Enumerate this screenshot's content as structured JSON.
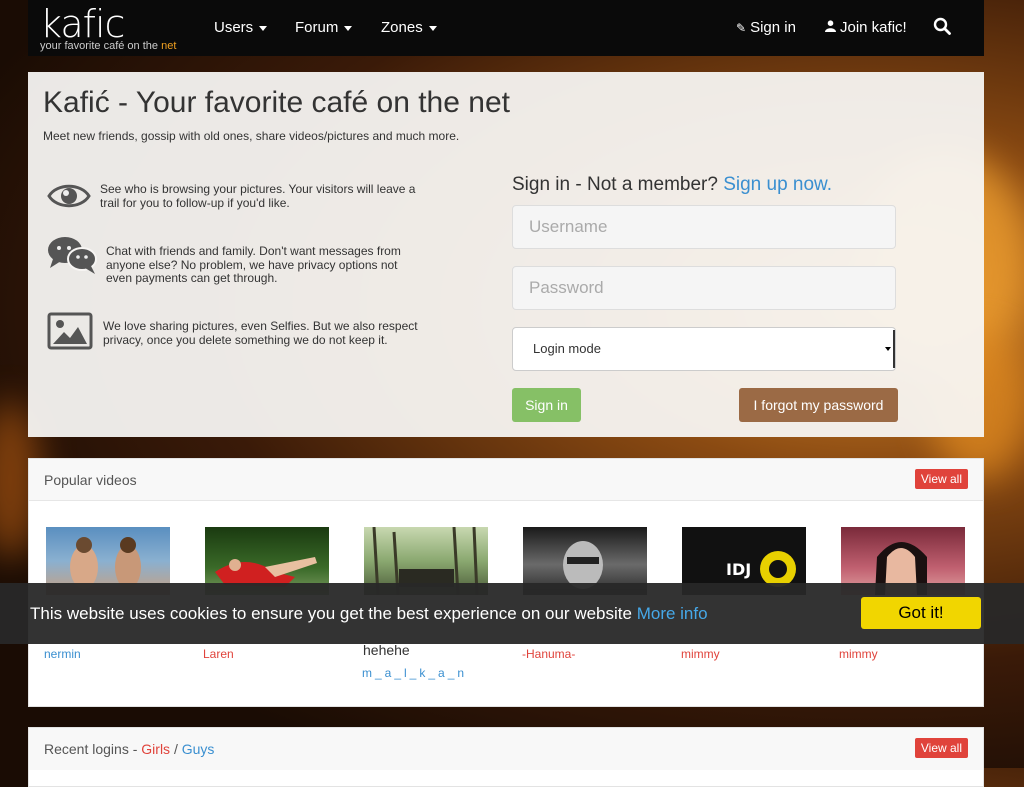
{
  "navbar": {
    "logo": {
      "word": "kafic",
      "tagline_prefix": "your favorite café on the ",
      "tagline_accent": "net"
    },
    "menu": [
      {
        "label": "Users"
      },
      {
        "label": "Forum"
      },
      {
        "label": "Zones"
      }
    ],
    "signin_label": "Sign in",
    "join_label": "Join kafic!",
    "search_icon": "search-icon"
  },
  "hero": {
    "title": "Kafić - Your favorite café on the net",
    "subtitle": "Meet new friends, gossip with old ones, share videos/pictures and much more.",
    "features": [
      {
        "icon": "eye-icon",
        "text": "See who is browsing your pictures. Your visitors will leave a trail for you to follow-up if you'd like."
      },
      {
        "icon": "chat-icon",
        "text": "Chat with friends and family. Don't want messages from anyone else? No problem, we have privacy options not even payments can get through."
      },
      {
        "icon": "picture-icon",
        "text": "We love sharing pictures, even Selfies. But we also respect privacy, once you delete something we do not keep it."
      }
    ]
  },
  "signin": {
    "heading": "Sign in - Not a member?",
    "signup_link": "Sign up now.",
    "username_placeholder": "Username",
    "password_placeholder": "Password",
    "login_mode_value": "Login mode",
    "submit_label": "Sign in",
    "forgot_label": "I forgot my password"
  },
  "popular_videos": {
    "title": "Popular videos",
    "view_all": "View all",
    "items": [
      {
        "title": "",
        "user": "nermin",
        "user_color": "blue"
      },
      {
        "title": "",
        "user": "Laren",
        "user_color": "red"
      },
      {
        "title": "hehehe",
        "user": "m_a_l_k_a_n",
        "user_color": "blue"
      },
      {
        "title": "",
        "user": "-Hanuma-",
        "user_color": "red"
      },
      {
        "title": "",
        "user": "mimmy",
        "user_color": "red"
      },
      {
        "title": "",
        "user": "mimmy",
        "user_color": "red"
      }
    ]
  },
  "recent_logins": {
    "title_prefix": "Recent logins - ",
    "girls": "Girls",
    "separator": " / ",
    "guys": "Guys",
    "view_all": "View all"
  },
  "cookie_bar": {
    "text": "This website uses cookies to ensure you get the best experience on our website",
    "more_info": "More info",
    "button": "Got it!"
  },
  "colors": {
    "brand_blue": "#3a8fd0",
    "danger_red": "#e0433b",
    "success_green": "#86c066",
    "brown": "#9b6a45",
    "cookie_yellow": "#f1d600"
  }
}
